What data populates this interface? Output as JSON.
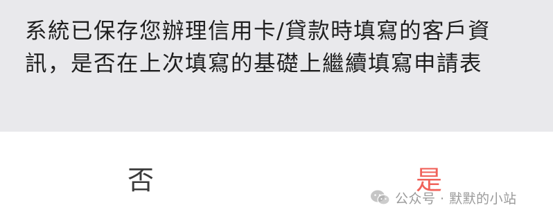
{
  "dialog": {
    "message": "系統已保存您辦理信用卡/貸款時填寫的客戶資訊，是否在上次填寫的基礎上繼續填寫申請表",
    "no_label": "否",
    "yes_label": "是"
  },
  "watermark": {
    "text": "公众号 · 默默的小站",
    "icon": "wechat-icon"
  },
  "colors": {
    "panel_background": "#e9e9ec",
    "yes_accent": "#f0625a",
    "no_text": "#3a3a3a"
  }
}
